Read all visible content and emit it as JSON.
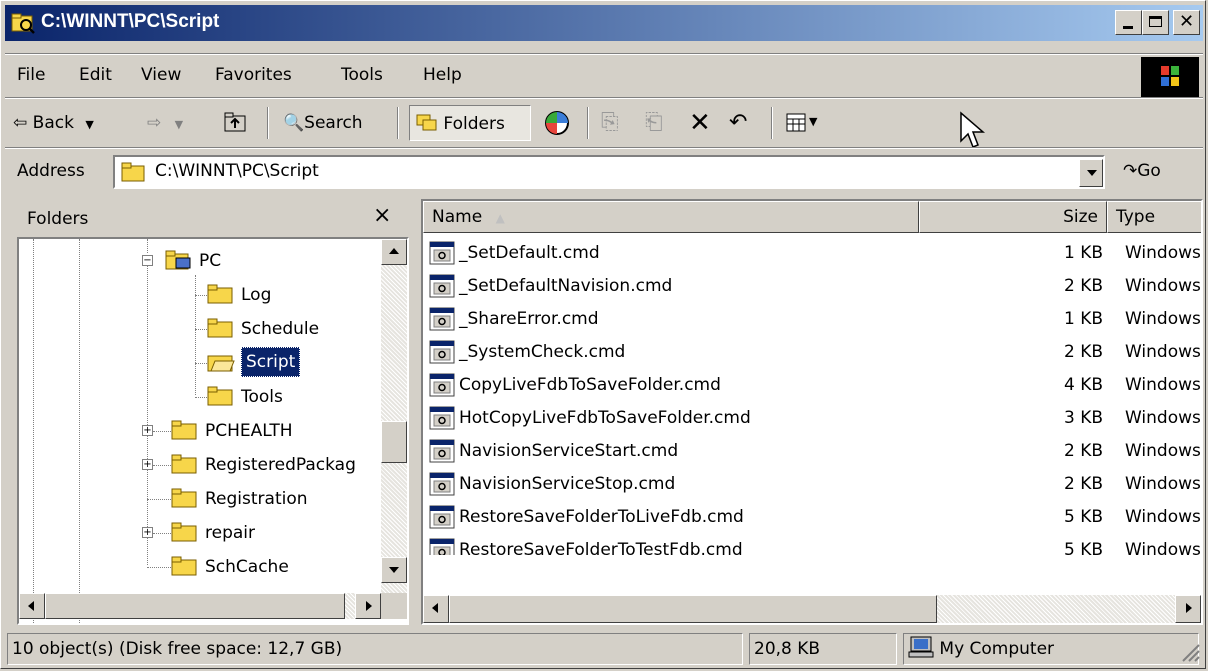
{
  "window": {
    "title": "C:\\WINNT\\PC\\Script"
  },
  "menu": {
    "items": [
      "File",
      "Edit",
      "View",
      "Favorites",
      "Tools",
      "Help"
    ]
  },
  "toolbar": {
    "back": "Back",
    "search": "Search",
    "folders": "Folders"
  },
  "address": {
    "label": "Address",
    "value": "C:\\WINNT\\PC\\Script",
    "go": "Go"
  },
  "folders_pane": {
    "title": "Folders",
    "close": "×",
    "items": [
      "PC",
      "Log",
      "Schedule",
      "Script",
      "Tools",
      "PCHEALTH",
      "RegisteredPackag",
      "Registration",
      "repair",
      "SchCache"
    ],
    "selected": "Script"
  },
  "file_list": {
    "columns": {
      "name": "Name",
      "size": "Size",
      "type": "Type"
    },
    "rows": [
      {
        "name": "_SetDefault.cmd",
        "size": "1 KB",
        "type": "Windows"
      },
      {
        "name": "_SetDefaultNavision.cmd",
        "size": "2 KB",
        "type": "Windows"
      },
      {
        "name": "_ShareError.cmd",
        "size": "1 KB",
        "type": "Windows"
      },
      {
        "name": "_SystemCheck.cmd",
        "size": "2 KB",
        "type": "Windows"
      },
      {
        "name": "CopyLiveFdbToSaveFolder.cmd",
        "size": "4 KB",
        "type": "Windows"
      },
      {
        "name": "HotCopyLiveFdbToSaveFolder.cmd",
        "size": "3 KB",
        "type": "Windows"
      },
      {
        "name": "NavisionServiceStart.cmd",
        "size": "2 KB",
        "type": "Windows"
      },
      {
        "name": "NavisionServiceStop.cmd",
        "size": "2 KB",
        "type": "Windows"
      },
      {
        "name": "RestoreSaveFolderToLiveFdb.cmd",
        "size": "5 KB",
        "type": "Windows"
      },
      {
        "name": "RestoreSaveFolderToTestFdb.cmd",
        "size": "5 KB",
        "type": "Windows"
      }
    ]
  },
  "status": {
    "objects": "10 object(s) (Disk free space: 12,7 GB)",
    "size": "20,8 KB",
    "zone": "My Computer"
  },
  "colors": {
    "title_start": "#0a246a",
    "title_end": "#a6caf0",
    "face": "#d4d0c8",
    "selection": "#0a246a",
    "folder": "#f7d64a"
  }
}
